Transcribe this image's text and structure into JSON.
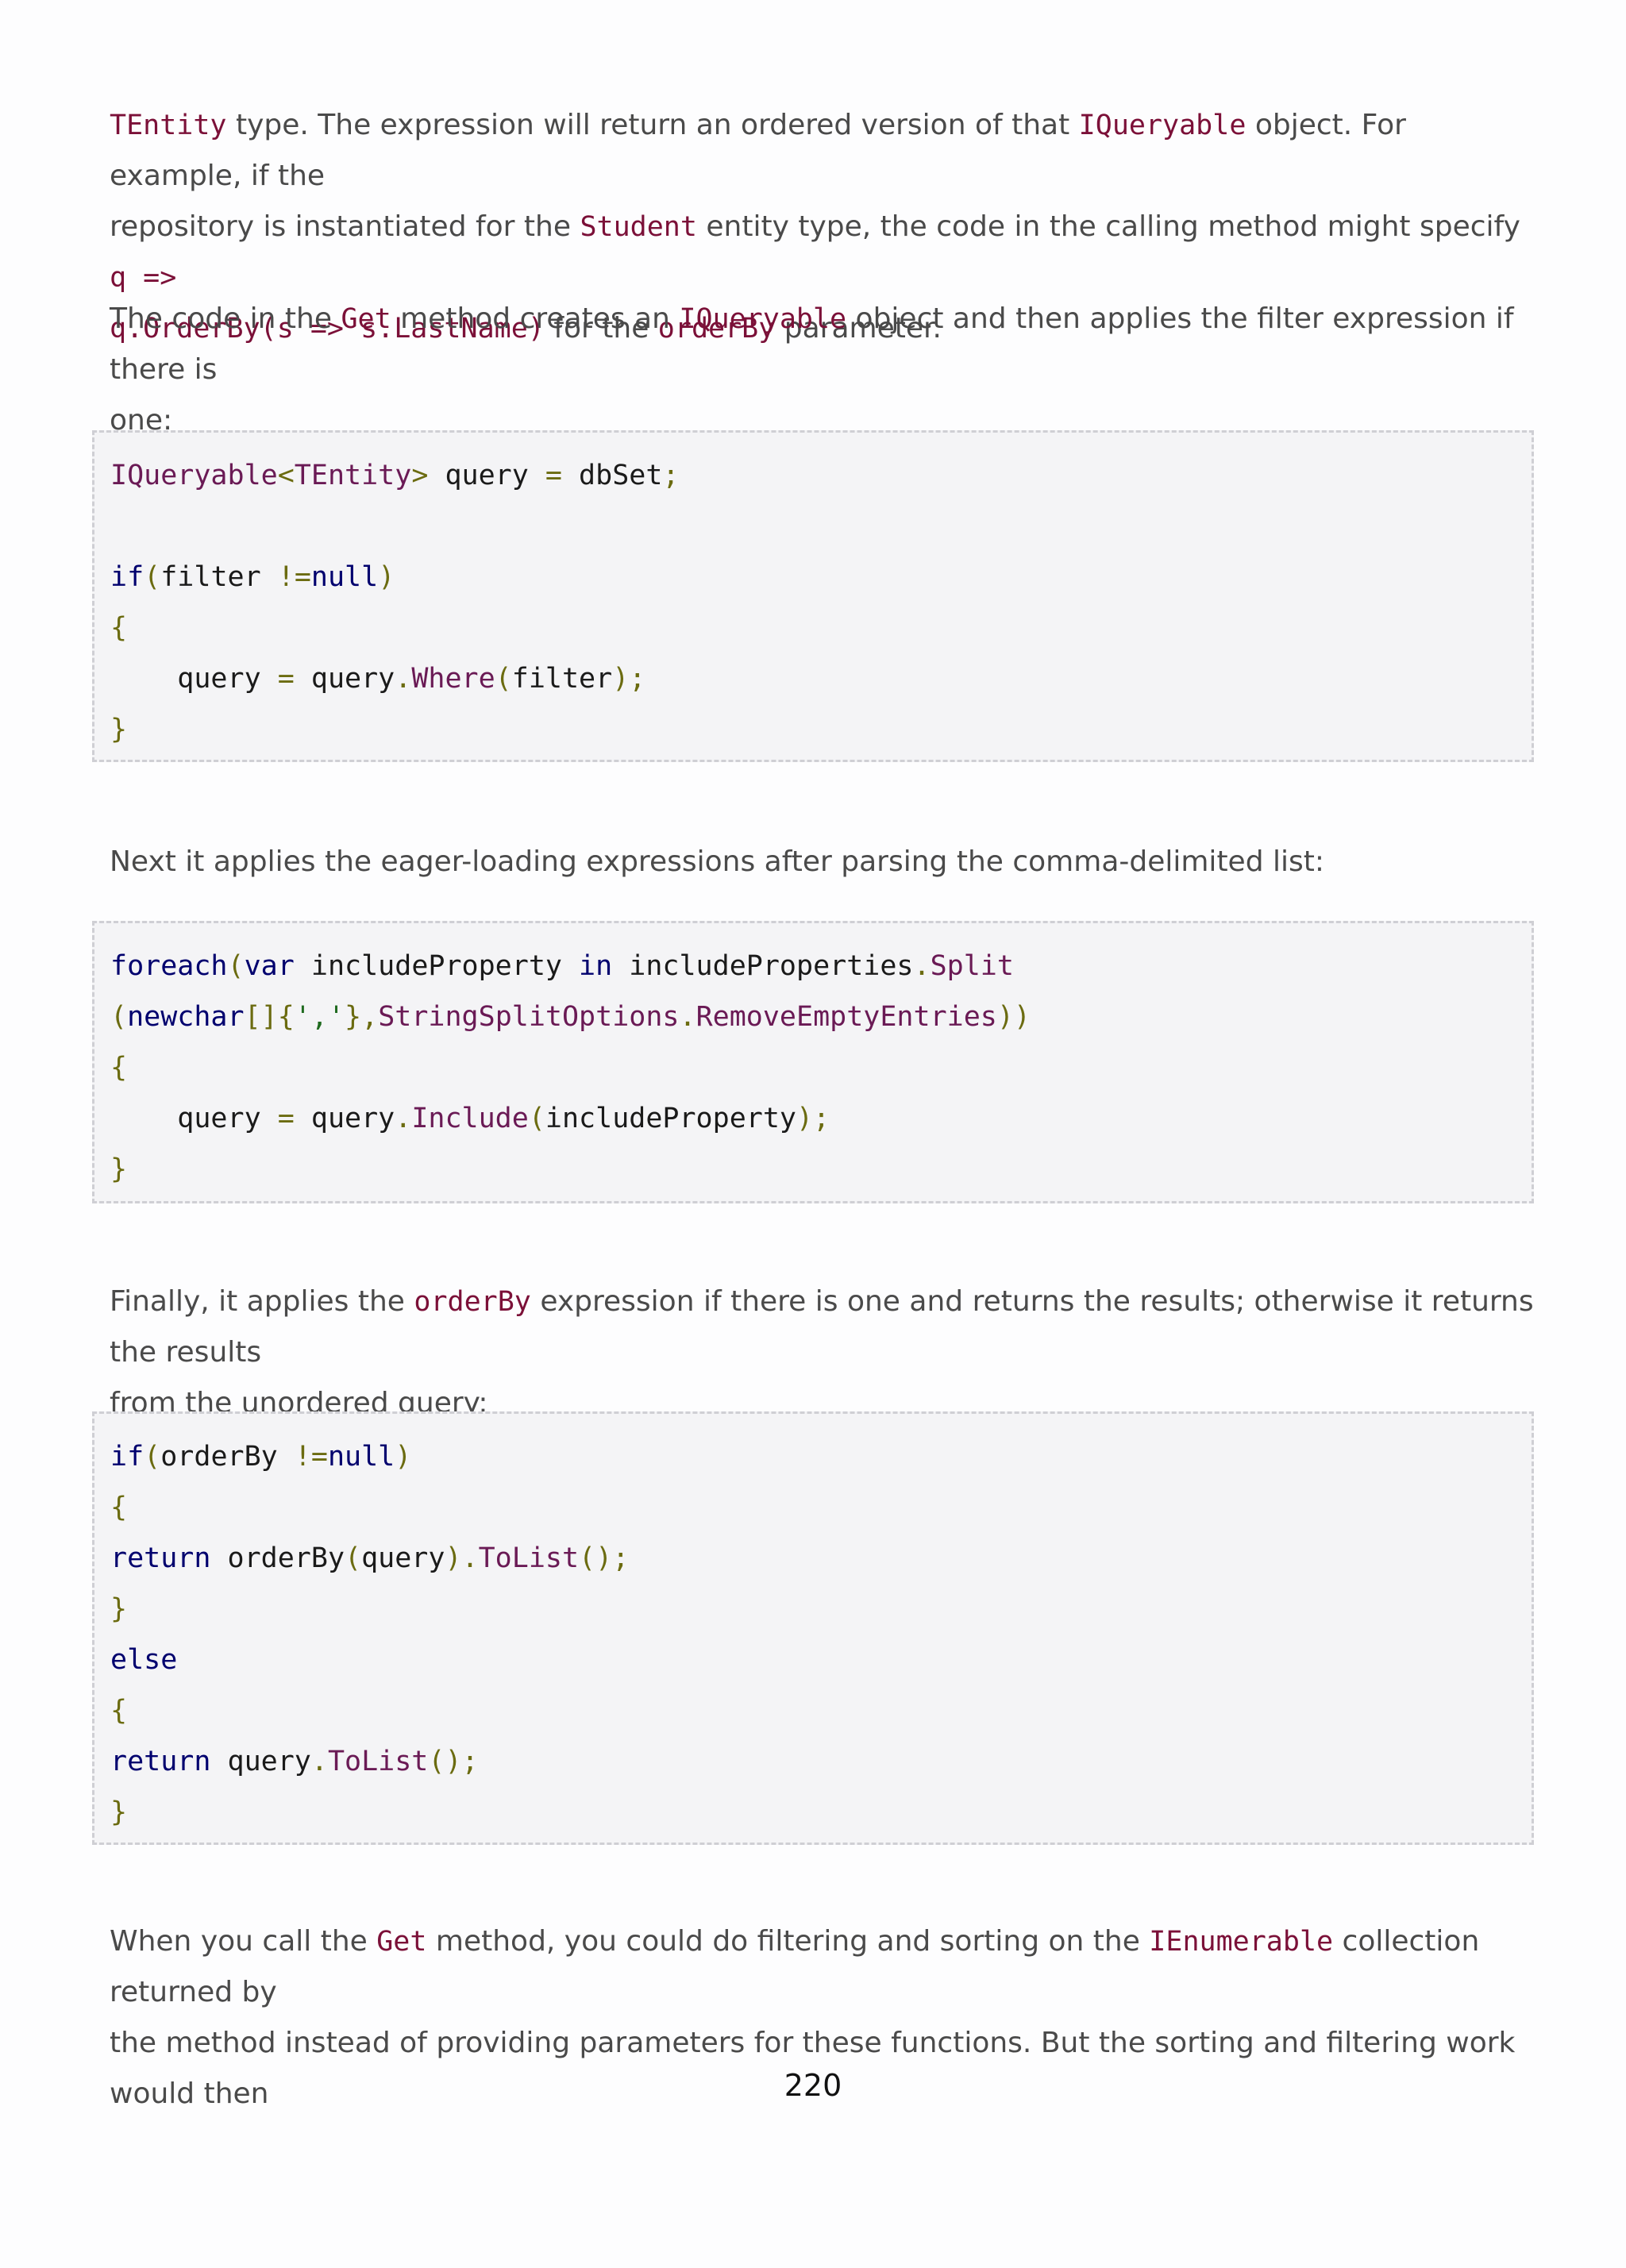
{
  "intro": {
    "l1_a": "TEntity",
    "l1_b": " type. The expression will return an ordered version of that ",
    "l1_c": "IQueryable",
    "l1_d": " object. For example, if the",
    "l2_a": "repository is instantiated for the ",
    "l2_b": "Student",
    "l2_c": " entity type, the code in the calling method might specify ",
    "l2_d": "q =>",
    "l3_a": "q.OrderBy(s => s.LastName)",
    "l3_b": " for the ",
    "l3_c": "orderBy",
    "l3_d": " parameter."
  },
  "para2": {
    "a": "The code in the ",
    "b": "Get",
    "c": " method creates an ",
    "d": "IQueryable",
    "e": " object and then applies the filter expression if there is",
    "f": "one:"
  },
  "code1": {
    "l1": [
      "IQueryable",
      "<",
      "TEntity",
      ">",
      " query ",
      "=",
      " dbSet",
      ";"
    ],
    "l3": [
      "if",
      "(",
      "filter ",
      "!=",
      "null",
      ")"
    ],
    "l4": "{",
    "l5": [
      "    query ",
      "=",
      " query",
      ".",
      "Where",
      "(",
      "filter",
      ");"
    ],
    "l6": "}"
  },
  "para3": "Next it applies the eager-loading expressions after parsing the comma-delimited list:",
  "code2": {
    "l1": [
      "foreach",
      "(",
      "var",
      " includeProperty ",
      "in",
      " includeProperties",
      ".",
      "Split"
    ],
    "l2": [
      "(",
      "newchar",
      "[]{",
      "','",
      "},",
      "StringSplitOptions",
      ".",
      "RemoveEmptyEntries",
      "))"
    ],
    "l3": "{",
    "l4": [
      "    query ",
      "=",
      " query",
      ".",
      "Include",
      "(",
      "includeProperty",
      ");"
    ],
    "l5": "}"
  },
  "para4": {
    "a": "Finally, it applies the ",
    "b": "orderBy",
    "c": " expression if there is one and returns the results; otherwise it returns the results",
    "d": "from the unordered query:"
  },
  "code3": {
    "l1": [
      "if",
      "(",
      "orderBy ",
      "!=",
      "null",
      ")"
    ],
    "l2": "{",
    "l3": [
      "return",
      " orderBy",
      "(",
      "query",
      ").",
      "ToList",
      "();"
    ],
    "l4": "}",
    "l5": "else",
    "l6": "{",
    "l7": [
      "return",
      " query",
      ".",
      "ToList",
      "();"
    ],
    "l8": "}"
  },
  "para5": {
    "a": "When you call the ",
    "b": "Get",
    "c": " method, you could do filtering and sorting on the ",
    "d": "IEnumerable",
    "e": " collection returned by",
    "f": "the method instead of providing parameters for these functions. But the sorting and filtering work would then"
  },
  "page_number": "220"
}
